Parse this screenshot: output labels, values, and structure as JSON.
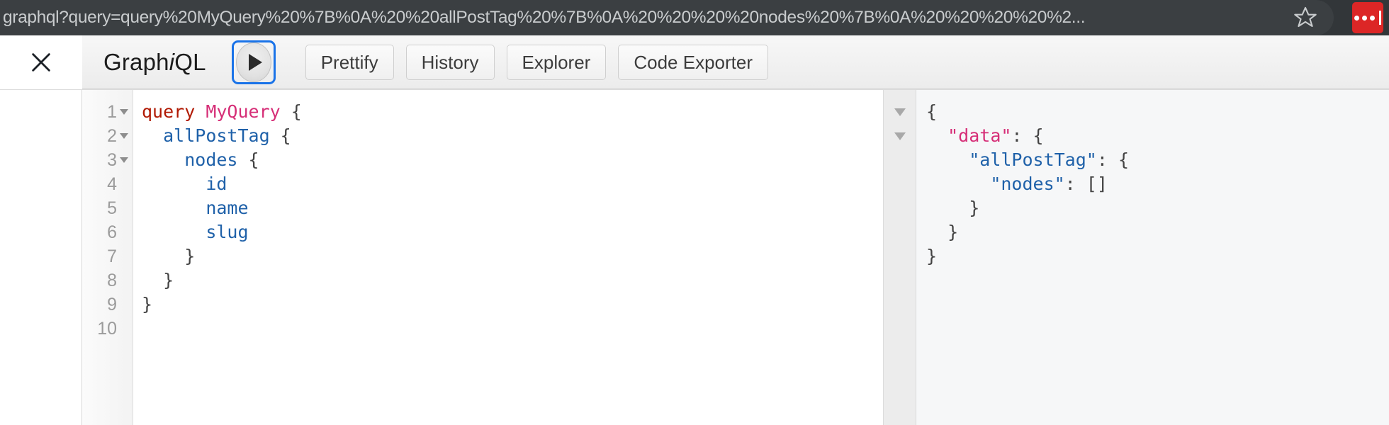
{
  "browser": {
    "url": "graphql?query=query%20MyQuery%20%7B%0A%20%20allPostTag%20%7B%0A%20%20%20%20nodes%20%7B%0A%20%20%20%20%2...",
    "bookmark_icon": "star-icon",
    "extension_icon": "extension-dots-icon",
    "chrome_bg": "#323639",
    "url_field_bg": "#3b3f42",
    "extension_color": "#dc2626"
  },
  "graphiql": {
    "close_icon": "close-icon",
    "title_prefix": "Graph",
    "title_italic": "i",
    "title_suffix": "QL",
    "execute_icon": "play-icon",
    "execute_focus_color": "#1a73e8",
    "buttons": [
      {
        "label": "Prettify",
        "name": "prettify-button"
      },
      {
        "label": "History",
        "name": "history-button"
      },
      {
        "label": "Explorer",
        "name": "explorer-button"
      },
      {
        "label": "Code Exporter",
        "name": "code-exporter-button"
      }
    ]
  },
  "editor": {
    "line_numbers": [
      "1",
      "2",
      "3",
      "4",
      "5",
      "6",
      "7",
      "8",
      "9",
      "10"
    ],
    "foldable_lines": [
      1,
      2,
      3
    ],
    "lines": [
      {
        "n": 1,
        "tokens": [
          {
            "t": "query",
            "c": "kw"
          },
          {
            "t": " ",
            "c": "punct"
          },
          {
            "t": "MyQuery",
            "c": "opname"
          },
          {
            "t": " {",
            "c": "punct"
          }
        ]
      },
      {
        "n": 2,
        "tokens": [
          {
            "t": "  ",
            "c": "punct"
          },
          {
            "t": "allPostTag",
            "c": "field"
          },
          {
            "t": " {",
            "c": "punct"
          }
        ]
      },
      {
        "n": 3,
        "tokens": [
          {
            "t": "    ",
            "c": "punct"
          },
          {
            "t": "nodes",
            "c": "field"
          },
          {
            "t": " {",
            "c": "punct"
          }
        ]
      },
      {
        "n": 4,
        "tokens": [
          {
            "t": "      ",
            "c": "punct"
          },
          {
            "t": "id",
            "c": "field"
          }
        ]
      },
      {
        "n": 5,
        "tokens": [
          {
            "t": "      ",
            "c": "punct"
          },
          {
            "t": "name",
            "c": "field"
          }
        ]
      },
      {
        "n": 6,
        "tokens": [
          {
            "t": "      ",
            "c": "punct"
          },
          {
            "t": "slug",
            "c": "field"
          }
        ]
      },
      {
        "n": 7,
        "tokens": [
          {
            "t": "    }",
            "c": "punct"
          }
        ]
      },
      {
        "n": 8,
        "tokens": [
          {
            "t": "  }",
            "c": "punct"
          }
        ]
      },
      {
        "n": 9,
        "tokens": [
          {
            "t": "}",
            "c": "punct"
          }
        ]
      },
      {
        "n": 10,
        "tokens": [
          {
            "t": "",
            "c": "punct"
          }
        ]
      }
    ]
  },
  "result": {
    "fold_arrows": 2,
    "lines": [
      {
        "tokens": [
          {
            "t": "{",
            "c": "jpunct"
          }
        ]
      },
      {
        "tokens": [
          {
            "t": "  ",
            "c": "jpunct"
          },
          {
            "t": "\"data\"",
            "c": "jkey-data"
          },
          {
            "t": ": {",
            "c": "jpunct"
          }
        ]
      },
      {
        "tokens": [
          {
            "t": "    ",
            "c": "jpunct"
          },
          {
            "t": "\"allPostTag\"",
            "c": "jkey"
          },
          {
            "t": ": {",
            "c": "jpunct"
          }
        ]
      },
      {
        "tokens": [
          {
            "t": "      ",
            "c": "jpunct"
          },
          {
            "t": "\"nodes\"",
            "c": "jkey"
          },
          {
            "t": ": []",
            "c": "jpunct"
          }
        ]
      },
      {
        "tokens": [
          {
            "t": "    }",
            "c": "jpunct"
          }
        ]
      },
      {
        "tokens": [
          {
            "t": "  }",
            "c": "jpunct"
          }
        ]
      },
      {
        "tokens": [
          {
            "t": "}",
            "c": "jpunct"
          }
        ]
      }
    ]
  }
}
